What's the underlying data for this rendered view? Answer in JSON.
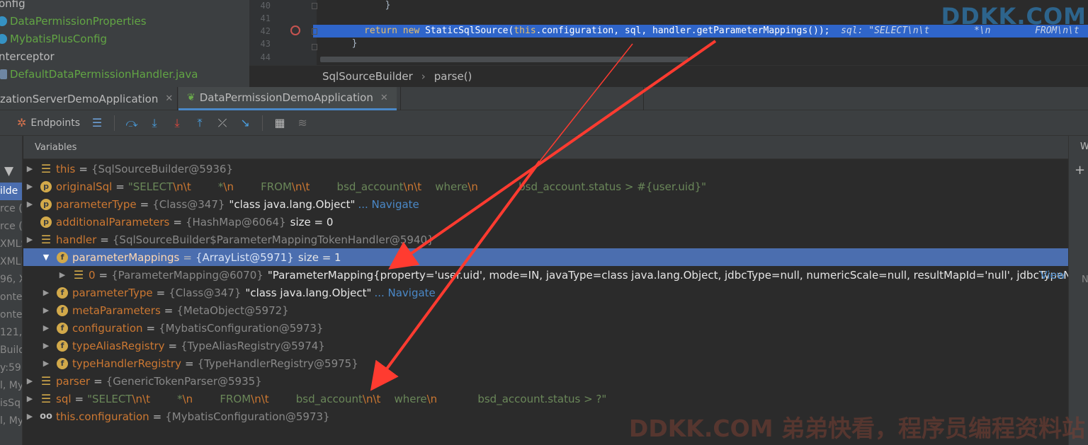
{
  "project_tree": {
    "items": [
      {
        "label": "onfig",
        "style": "plain",
        "icon": "none"
      },
      {
        "label": "DataPermissionProperties",
        "style": "green",
        "icon": "class-icon"
      },
      {
        "label": "MybatisPlusConfig",
        "style": "green",
        "icon": "class-icon"
      },
      {
        "label": "nterceptor",
        "style": "plain",
        "icon": "none"
      },
      {
        "label": "DefaultDataPermissionHandler.java",
        "style": "green",
        "icon": "file-icon"
      },
      {
        "label": "DefaultDataPermissionInterceptor",
        "style": "green",
        "icon": "class-icon"
      }
    ]
  },
  "editor": {
    "lines": [
      {
        "num": "40",
        "code": "        }"
      },
      {
        "num": "41",
        "code": ""
      },
      {
        "num": "42",
        "code": "    return new StaticSqlSource(this.configuration, sql, handler.getParameterMappings());",
        "hint": "  sql: \"SELECT\\n\\t        *\\n        FROM\\n\\t"
      },
      {
        "num": "43",
        "code": "  }"
      },
      {
        "num": "44",
        "code": ""
      }
    ],
    "watermark": "DDKK.COM"
  },
  "breadcrumb": {
    "items": [
      "SqlSourceBuilder",
      "parse()"
    ],
    "separator": "›"
  },
  "run_tabs": [
    {
      "label": "zationServerDemoApplication",
      "active": false
    },
    {
      "label": "DataPermissionDemoApplication",
      "active": true
    }
  ],
  "toolbar": {
    "endpoints_label": "Endpoints"
  },
  "left_strip": {
    "fragments": [
      "ilde",
      "rce (/",
      "rce (/",
      "XMLS",
      "XMLL",
      "96, X",
      "onte",
      "onte",
      "121,",
      "Build",
      "y:59",
      "l, My",
      "isSq",
      "l, My"
    ]
  },
  "variables": {
    "header": "Variables",
    "rows": [
      {
        "indent": 0,
        "arrow": "collapsed",
        "icon": "lines",
        "name": "this",
        "type": "{SqlSourceBuilder@5936}",
        "value": ""
      },
      {
        "indent": 0,
        "arrow": "collapsed",
        "icon": "p",
        "name": "originalSql",
        "type": "",
        "string_parts": [
          "\"SELECT",
          "\\n\\t",
          "        *",
          "\\n",
          "        FROM",
          "\\n\\t",
          "        bsd_account",
          "\\n\\t",
          "    where",
          "\\n",
          "            bsd_account.status > #{user.uid}\""
        ]
      },
      {
        "indent": 0,
        "arrow": "collapsed",
        "icon": "p",
        "name": "parameterType",
        "type": "{Class@347}",
        "value": "\"class java.lang.Object\"",
        "link": "... Navigate"
      },
      {
        "indent": 0,
        "arrow": "none",
        "icon": "p",
        "name": "additionalParameters",
        "type": "{HashMap@6064}",
        "size": "size = 0"
      },
      {
        "indent": 0,
        "arrow": "collapsed",
        "icon": "lines",
        "name": "handler",
        "type": "{SqlSourceBuilder$ParameterMappingTokenHandler@5940}",
        "value": ""
      },
      {
        "indent": 1,
        "arrow": "expanded",
        "icon": "f",
        "name": "parameterMappings",
        "type": "{ArrayList@5971}",
        "size": "size = 1",
        "selected": true
      },
      {
        "indent": 2,
        "arrow": "collapsed",
        "icon": "lines",
        "name": "0",
        "type": "{ParameterMapping@6070}",
        "value": "\"ParameterMapping{property='user.uid', mode=IN, javaType=class java.lang.Object, jdbcType=null, numericScale=null, resultMapId='null', jdbcTypeN...",
        "view": "View"
      },
      {
        "indent": 1,
        "arrow": "collapsed",
        "icon": "f",
        "name": "parameterType",
        "type": "{Class@347}",
        "value": "\"class java.lang.Object\"",
        "link": "... Navigate"
      },
      {
        "indent": 1,
        "arrow": "collapsed",
        "icon": "f",
        "name": "metaParameters",
        "type": "{MetaObject@5972}",
        "value": ""
      },
      {
        "indent": 1,
        "arrow": "collapsed",
        "icon": "f",
        "name": "configuration",
        "type": "{MybatisConfiguration@5973}",
        "value": ""
      },
      {
        "indent": 1,
        "arrow": "collapsed",
        "icon": "f",
        "name": "typeAliasRegistry",
        "type": "{TypeAliasRegistry@5974}",
        "value": ""
      },
      {
        "indent": 1,
        "arrow": "collapsed",
        "icon": "f",
        "name": "typeHandlerRegistry",
        "type": "{TypeHandlerRegistry@5975}",
        "value": ""
      },
      {
        "indent": 0,
        "arrow": "collapsed",
        "icon": "lines",
        "name": "parser",
        "type": "{GenericTokenParser@5935}",
        "value": ""
      },
      {
        "indent": 0,
        "arrow": "collapsed",
        "icon": "lines",
        "name": "sql",
        "type": "",
        "string_parts": [
          "\"SELECT",
          "\\n\\t",
          "        *",
          "\\n",
          "        FROM",
          "\\n\\t",
          "        bsd_account",
          "\\n\\t",
          "    where",
          "\\n",
          "            bsd_account.status > ?\""
        ]
      },
      {
        "indent": 0,
        "arrow": "collapsed",
        "icon": "oo",
        "name": "this.configuration",
        "type": "{MybatisConfiguration@5973}",
        "value": ""
      }
    ]
  },
  "right_strip": {
    "top_label": "W",
    "bottom_label": "N"
  },
  "watermark_bottom": "DDKK.COM 弟弟快看，程序员编程资料站",
  "colors": {
    "annotation_arrow": "#ff3b30",
    "selection": "#4b6eaf",
    "breakpoint": "#c75450"
  }
}
